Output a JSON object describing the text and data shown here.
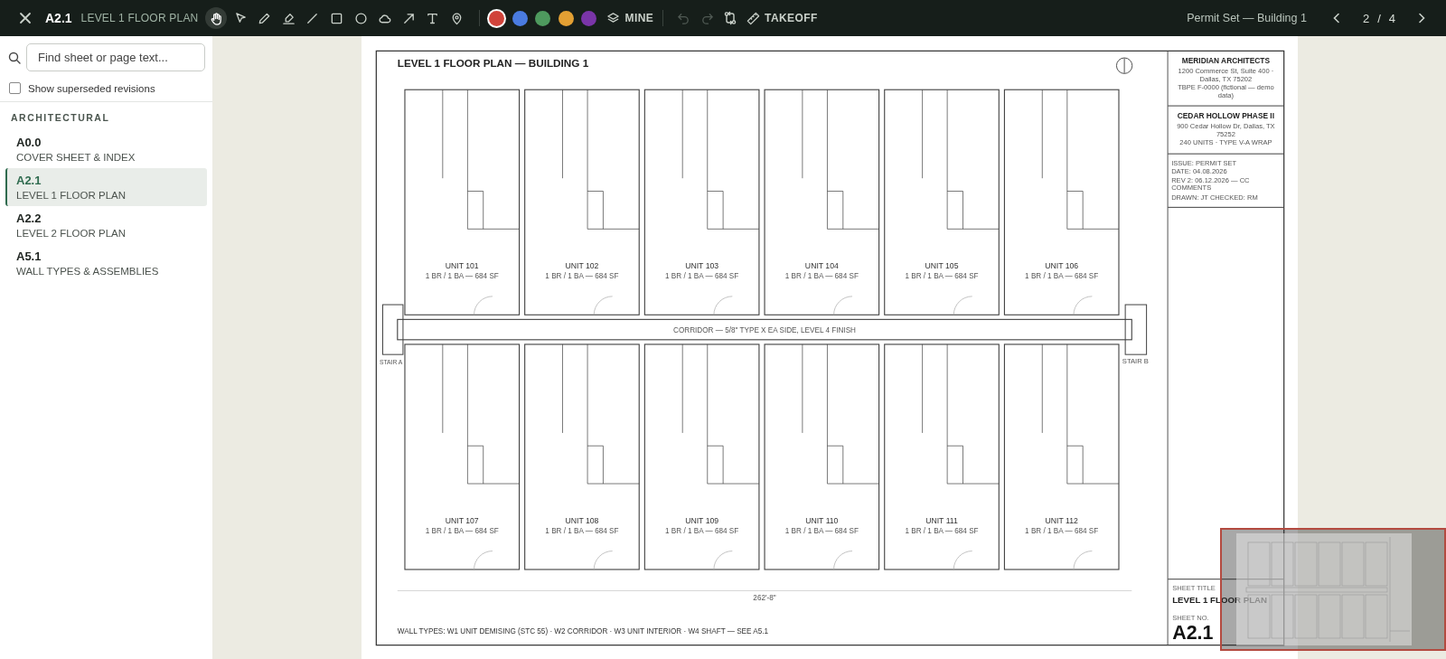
{
  "toolbar": {
    "sheet_number": "A2.1",
    "sheet_title": "LEVEL 1 FLOOR PLAN",
    "tools": [
      {
        "kind": "hand",
        "selected": true
      },
      {
        "kind": "pointer",
        "selected": false
      },
      {
        "kind": "pencil",
        "selected": false
      },
      {
        "kind": "highlighter",
        "selected": false
      },
      {
        "kind": "line",
        "selected": false
      },
      {
        "kind": "rectangle",
        "selected": false
      },
      {
        "kind": "circle",
        "selected": false
      },
      {
        "kind": "cloud",
        "selected": false
      },
      {
        "kind": "arrow",
        "selected": false
      },
      {
        "kind": "text",
        "selected": false
      },
      {
        "kind": "pin",
        "selected": false
      }
    ],
    "colors": [
      {
        "color": "#d0433a",
        "selected": true
      },
      {
        "color": "#4a7be0",
        "selected": false
      },
      {
        "color": "#4e9a5e",
        "selected": false
      },
      {
        "color": "#e3a033",
        "selected": false
      },
      {
        "color": "#7a35a8",
        "selected": false
      }
    ],
    "layer_button": "MINE",
    "undo": {
      "disabled": true
    },
    "redo": {
      "disabled": true
    },
    "takeoff_button": "TAKEOFF",
    "set_name": "Permit Set — Building 1",
    "page": "2",
    "page_separator": "/",
    "page_total": "4"
  },
  "sidebar": {
    "search": {
      "placeholder": "Find sheet or page text..."
    },
    "superseded": {
      "label": "Show superseded revisions",
      "checked": false
    },
    "groups": [
      {
        "name": "ARCHITECTURAL",
        "sheets": [
          {
            "number": "A0.0",
            "title": "COVER SHEET & INDEX",
            "selected": false
          },
          {
            "number": "A2.1",
            "title": "LEVEL 1 FLOOR PLAN",
            "selected": true
          },
          {
            "number": "A2.2",
            "title": "LEVEL 2 FLOOR PLAN",
            "selected": false
          },
          {
            "number": "A5.1",
            "title": "WALL TYPES & ASSEMBLIES",
            "selected": false
          }
        ]
      }
    ]
  },
  "sheet": {
    "title": "LEVEL 1 FLOOR PLAN — BUILDING 1",
    "units": [
      {
        "name": "UNIT 101",
        "info": "1 BR / 1 BA — 684 SF"
      },
      {
        "name": "UNIT 102",
        "info": "1 BR / 1 BA — 684 SF"
      },
      {
        "name": "UNIT 103",
        "info": "1 BR / 1 BA — 684 SF"
      },
      {
        "name": "UNIT 104",
        "info": "1 BR / 1 BA — 684 SF"
      },
      {
        "name": "UNIT 105",
        "info": "1 BR / 1 BA — 684 SF"
      },
      {
        "name": "UNIT 106",
        "info": "1 BR / 1 BA — 684 SF"
      },
      {
        "name": "UNIT 107",
        "info": "1 BR / 1 BA — 684 SF"
      },
      {
        "name": "UNIT 108",
        "info": "1 BR / 1 BA — 684 SF"
      },
      {
        "name": "UNIT 109",
        "info": "1 BR / 1 BA — 684 SF"
      },
      {
        "name": "UNIT 110",
        "info": "1 BR / 1 BA — 684 SF"
      },
      {
        "name": "UNIT 111",
        "info": "1 BR / 1 BA — 684 SF"
      },
      {
        "name": "UNIT 112",
        "info": "1 BR / 1 BA — 684 SF"
      }
    ],
    "corridor": "CORRIDOR — 5/8\" TYPE X EA SIDE, LEVEL 4 FINISH",
    "stairs": [
      "STAIR A",
      "STAIR B"
    ],
    "dimension": "262'-8\"",
    "wall_types": "WALL TYPES: W1 UNIT DEMISING (STC 55) · W2 CORRIDOR · W3 UNIT INTERIOR · W4 SHAFT — SEE A5.1",
    "title_block": {
      "firm": "MERIDIAN ARCHITECTS",
      "firm_lines": [
        "1200 Commerce St, Suite 400 · Dallas, TX 75202",
        "TBPE F-0000 (fictional — demo data)"
      ],
      "project": "CEDAR HOLLOW PHASE II",
      "project_lines": [
        "900 Cedar Hollow Dr, Dallas, TX 75252",
        "240 UNITS · TYPE V-A WRAP"
      ],
      "issue_lines": [
        "ISSUE: PERMIT SET",
        "DATE: 04.08.2026",
        "REV 2: 06.12.2026 — CC COMMENTS",
        "DRAWN: JT   CHECKED: RM"
      ],
      "sheet_title_label": "SHEET TITLE",
      "sheet_title": "LEVEL 1 FLOOR PLAN",
      "sheet_no_label": "SHEET NO.",
      "sheet_no": "A2.1"
    }
  }
}
